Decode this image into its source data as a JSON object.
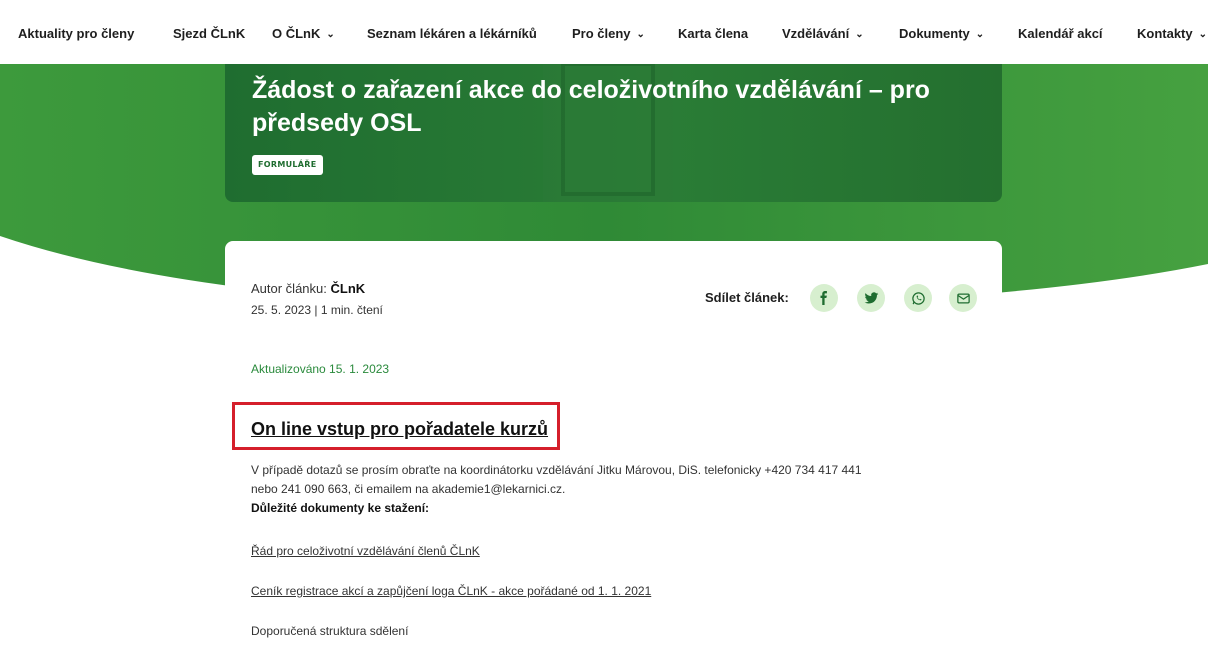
{
  "nav": {
    "items": [
      {
        "label": "Aktuality pro členy"
      },
      {
        "label": "Sjezd ČLnK"
      },
      {
        "label": "O ČLnK"
      },
      {
        "label": "Seznam lékáren a lékárníků"
      },
      {
        "label": "Pro členy"
      },
      {
        "label": "Karta člena"
      },
      {
        "label": "Vzdělávání"
      },
      {
        "label": "Dokumenty"
      },
      {
        "label": "Kalendář akcí"
      },
      {
        "label": "Kontakty"
      }
    ],
    "chevron_icon": "chevron-down-icon"
  },
  "hero": {
    "title": "Žádost o zařazení akce do celoživotního vzdělávání – pro předsedy OSL",
    "badge": "FORMULÁŘE"
  },
  "article": {
    "author_label": "Autor článku:",
    "author_name": "ČLnK",
    "date": "25. 5. 2023",
    "read_time": "1 min. čtení",
    "share_label": "Sdílet článek:",
    "share_icons": [
      "facebook-icon",
      "twitter-icon",
      "whatsapp-icon",
      "email-icon"
    ],
    "updated": "Aktualizováno 15. 1. 2023",
    "heading": "On line vstup pro pořadatele kurzů",
    "paragraph_line1": "V případě dotazů se prosím obraťte na koordinátorku vzdělávání Jitku Márovou, DiS. telefonicky +420 734 417 441",
    "paragraph_line2": "nebo 241 090 663, či emailem na akademie1@lekarnici.cz.",
    "documents_label": "Důležité dokumenty ke stažení:",
    "link1": "Řád pro celoživotní vzdělávání členů ČLnK",
    "link2": "Ceník registrace akcí a zapůjčení loga ČLnK - akce pořádané od 1. 1. 2021",
    "plain1": "Doporučená struktura sdělení"
  },
  "colors": {
    "brand_green": "#2a7d36",
    "light_green": "#d7efcf",
    "highlight_red": "#d51f2b"
  }
}
